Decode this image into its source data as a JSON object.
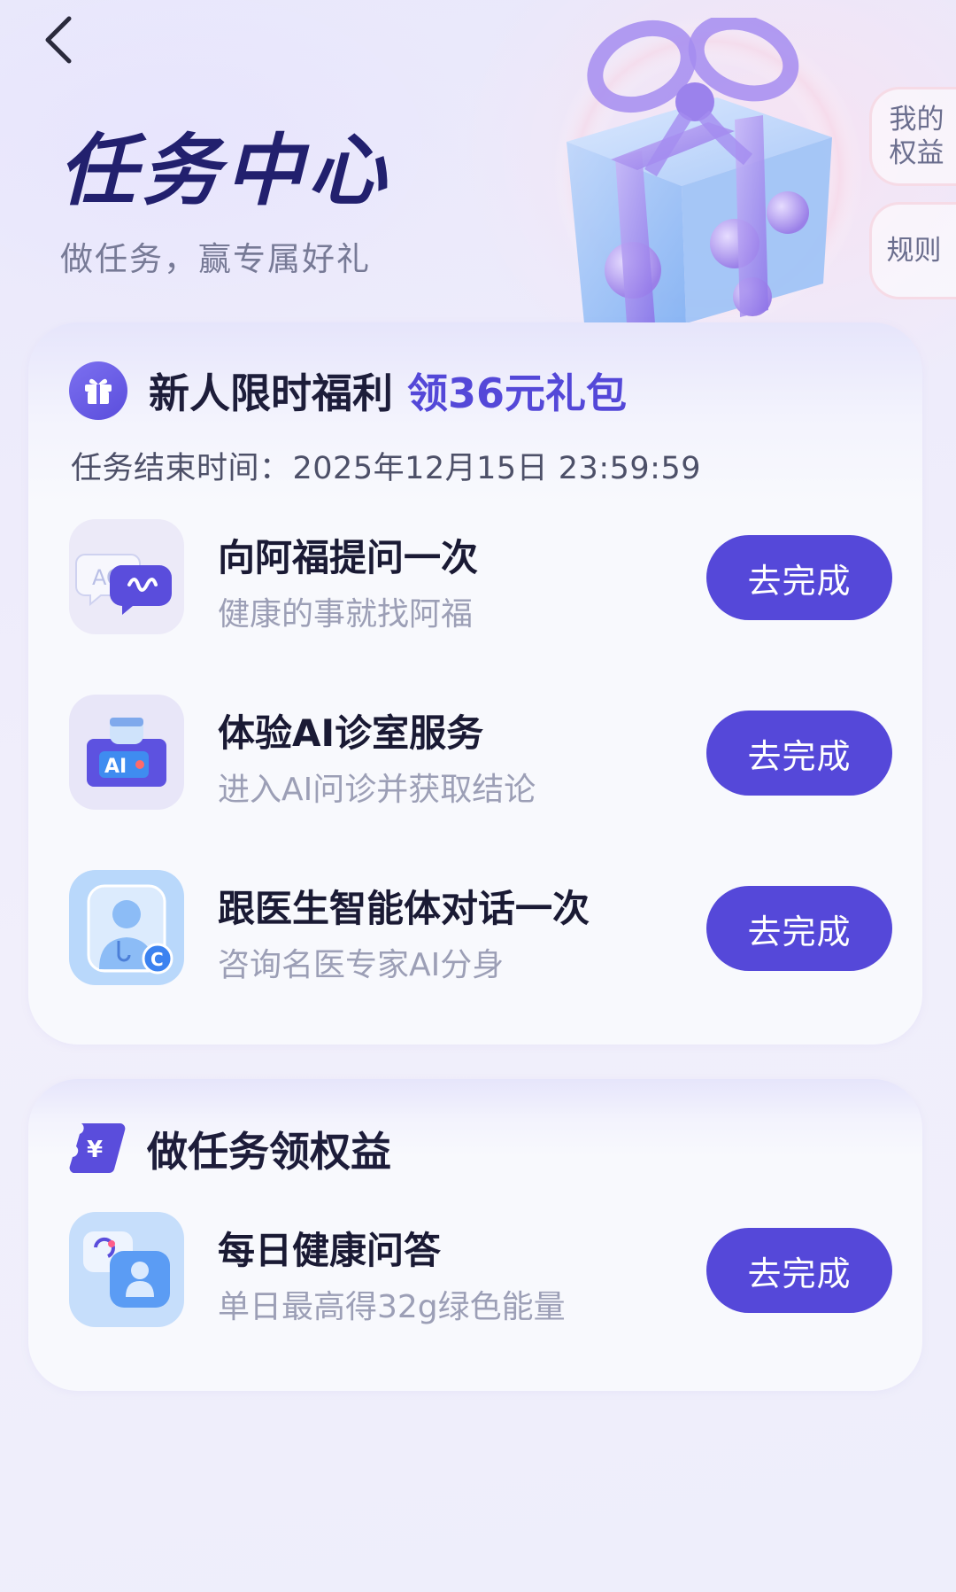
{
  "header": {
    "title": "任务中心",
    "subtitle": "做任务，赢专属好礼",
    "back_icon": "chevron-left-icon"
  },
  "side_tabs": [
    {
      "label_line1": "我的",
      "label_line2": "权益"
    },
    {
      "label": "规则"
    }
  ],
  "newcomer_section": {
    "title": "新人限时福利",
    "highlight": "领36元礼包",
    "deadline_label": "任务结束时间：",
    "deadline_value": "2025年12月15日 23:59:59",
    "icon": "gift-icon",
    "tasks": [
      {
        "title": "向阿福提问一次",
        "desc": "健康的事就找阿福",
        "button": "去完成",
        "icon": "chat-bubble-icon"
      },
      {
        "title": "体验AI诊室服务",
        "desc": "进入AI问诊并获取结论",
        "button": "去完成",
        "icon": "ai-doctor-icon"
      },
      {
        "title": "跟医生智能体对话一次",
        "desc": "咨询名医专家AI分身",
        "button": "去完成",
        "icon": "doctor-avatar-icon"
      }
    ]
  },
  "rights_section": {
    "title": "做任务领权益",
    "icon": "yen-coupon-icon",
    "tasks": [
      {
        "title": "每日健康问答",
        "desc": "单日最高得32g绿色能量",
        "button": "去完成",
        "icon": "user-chat-icon"
      }
    ]
  },
  "colors": {
    "accent": "#5548d9",
    "title": "#22206e",
    "muted_text": "#9c9fb6"
  }
}
